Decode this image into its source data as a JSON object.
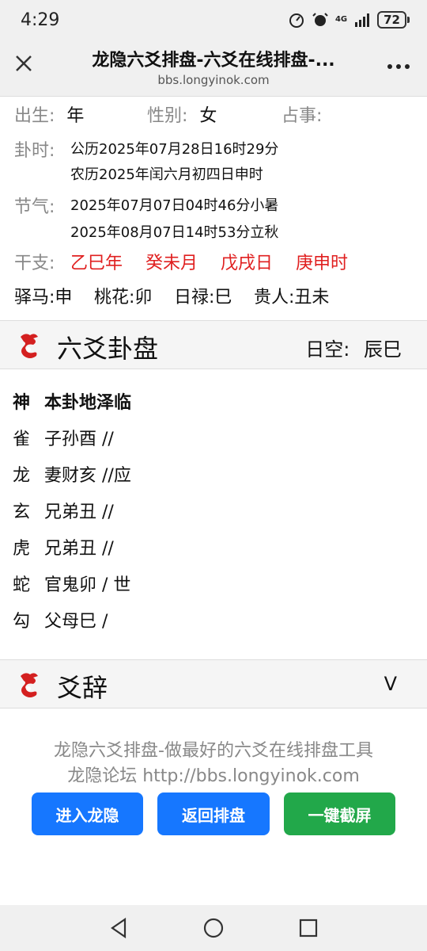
{
  "status": {
    "time": "4:29",
    "net_label": "4G",
    "battery": "72"
  },
  "browser": {
    "title": "龙隐六爻排盘-六爻在线排盘-...",
    "url": "bbs.longyinok.com"
  },
  "info": {
    "birth_label": "出生:",
    "birth_value": "年",
    "gender_label": "性别:",
    "gender_value": "女",
    "matter_label": "占事:",
    "time_label": "卦时:",
    "time_solar": "公历2025年07月28日16时29分",
    "time_lunar": "农历2025年闰六月初四日申时",
    "solar_term_label": "节气:",
    "solar_term_1": "2025年07月07日04时46分小暑",
    "solar_term_2": "2025年08月07日14时53分立秋",
    "ganzhi_label": "干支:",
    "ganzhi": [
      "乙巳年",
      "癸未月",
      "戊戌日",
      "庚申时"
    ],
    "shensha": [
      "驿马:申",
      "桃花:卯",
      "日禄:巳",
      "贵人:丑未"
    ]
  },
  "paipan": {
    "title": "六爻卦盘",
    "kong_label": "日空:",
    "kong_value": "辰巳",
    "header_god": "神",
    "header_gua": "本卦地泽临",
    "rows": [
      {
        "god": "雀",
        "text": "子孙酉 //"
      },
      {
        "god": "龙",
        "text": "妻财亥 //应"
      },
      {
        "god": "玄",
        "text": "兄弟丑 //"
      },
      {
        "god": "虎",
        "text": "兄弟丑 //"
      },
      {
        "god": "蛇",
        "text": "官鬼卯  / 世"
      },
      {
        "god": "勾",
        "text": "父母巳  /"
      }
    ]
  },
  "yaoci": {
    "title": "爻辞",
    "toggle": "V"
  },
  "footer": {
    "line1": "龙隐六爻排盘-做最好的六爻在线排盘工具",
    "line2": "龙隐论坛 http://bbs.longyinok.com",
    "btn_enter": "进入龙隐",
    "btn_back": "返回排盘",
    "btn_screenshot": "一键截屏"
  },
  "colors": {
    "accent_blue": "#1677ff",
    "accent_green": "#22a84a",
    "ganzhi_red": "#e02020",
    "icon_red": "#d42020"
  }
}
